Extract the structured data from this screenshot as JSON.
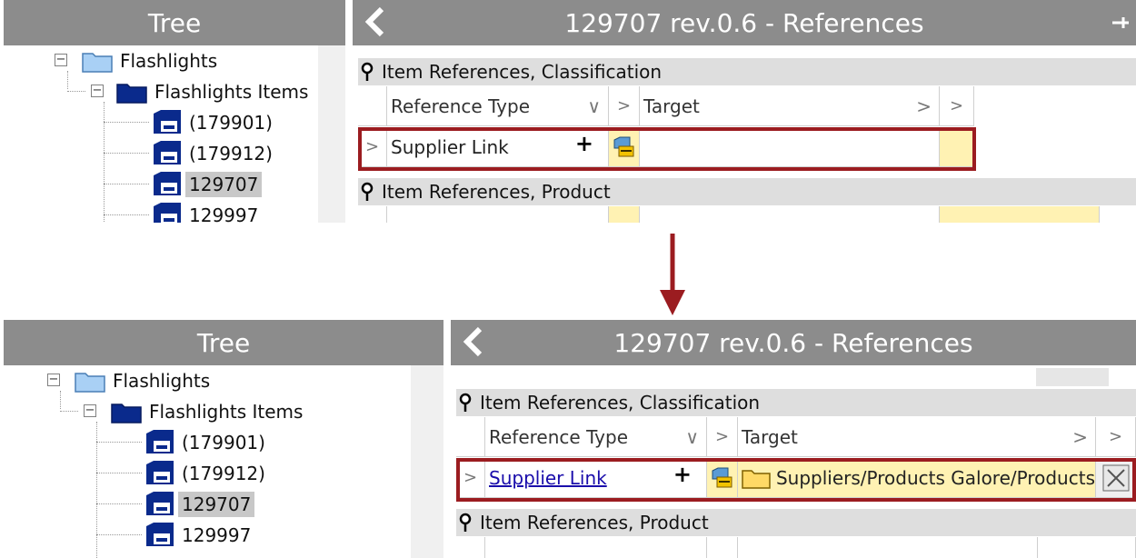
{
  "tree_title": "Tree",
  "references_title": "129707 rev.0.6 - References",
  "tree_items": {
    "flashlights": "Flashlights",
    "flashlights_items": "Flashlights Items",
    "item1": "(179901)",
    "item2": "(179912)",
    "item3": "129707",
    "item4": "129997"
  },
  "sections": {
    "classification": "Item References, Classification",
    "product": "Item References, Product"
  },
  "columns": {
    "reference_type": "Reference Type",
    "target": "Target",
    "ref_type_dropdown": "∨",
    "chevron": ">"
  },
  "before": {
    "row_label": "Supplier Link",
    "plus": "+"
  },
  "after": {
    "row_label": "Supplier Link",
    "plus": "+",
    "target_value": "Suppliers/Products Galore/Products"
  },
  "colors": {
    "title_bar": "#8c8c8c",
    "highlight": "#9b1c20",
    "arrow": "#9b1c20",
    "folder_light": "#a9d0f5",
    "folder_dark": "#0a2a8c",
    "cell_yellow": "#fff2b3"
  },
  "icons": [
    "back-chevron-icon",
    "pin-icon",
    "folder-icon",
    "item-icon",
    "link-target-icon",
    "clear-x-icon"
  ]
}
